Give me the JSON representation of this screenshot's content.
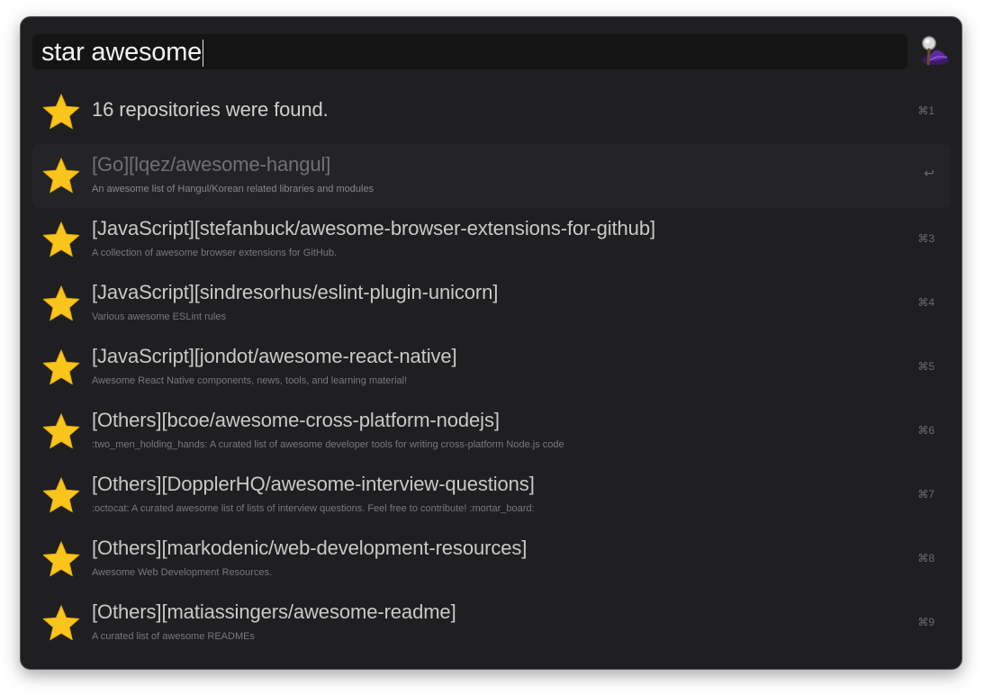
{
  "search": {
    "query": "star awesome"
  },
  "app_icon": "alfred-hat-magnifier-icon",
  "colors": {
    "window_bg": "#1f1f21",
    "search_bg": "#141415",
    "star": "#f9c51c",
    "title_text": "#c9c9c9",
    "subtitle_text": "#79797c"
  },
  "results": [
    {
      "title": "16 repositories were found.",
      "subtitle": "",
      "shortcut": "⌘1",
      "icon": "star-icon"
    },
    {
      "title": "[Go][lqez/awesome-hangul]",
      "subtitle": "An awesome list of Hangul/Korean related libraries and modules",
      "shortcut": "↩",
      "icon": "star-icon",
      "selected": true
    },
    {
      "title": "[JavaScript][stefanbuck/awesome-browser-extensions-for-github]",
      "subtitle": "A collection of awesome browser extensions for GitHub.",
      "shortcut": "⌘3",
      "icon": "star-icon"
    },
    {
      "title": "[JavaScript][sindresorhus/eslint-plugin-unicorn]",
      "subtitle": "Various awesome ESLint rules",
      "shortcut": "⌘4",
      "icon": "star-icon"
    },
    {
      "title": "[JavaScript][jondot/awesome-react-native]",
      "subtitle": "Awesome React Native components, news, tools, and learning material!",
      "shortcut": "⌘5",
      "icon": "star-icon"
    },
    {
      "title": "[Others][bcoe/awesome-cross-platform-nodejs]",
      "subtitle": ":two_men_holding_hands: A curated list of awesome developer tools for writing cross-platform Node.js code",
      "shortcut": "⌘6",
      "icon": "star-icon"
    },
    {
      "title": "[Others][DopplerHQ/awesome-interview-questions]",
      "subtitle": ":octocat: A curated awesome list of lists of interview questions. Feel free to contribute! :mortar_board:",
      "shortcut": "⌘7",
      "icon": "star-icon"
    },
    {
      "title": "[Others][markodenic/web-development-resources]",
      "subtitle": "Awesome Web Development Resources.",
      "shortcut": "⌘8",
      "icon": "star-icon"
    },
    {
      "title": "[Others][matiassingers/awesome-readme]",
      "subtitle": "A curated list of awesome READMEs",
      "shortcut": "⌘9",
      "icon": "star-icon"
    }
  ]
}
